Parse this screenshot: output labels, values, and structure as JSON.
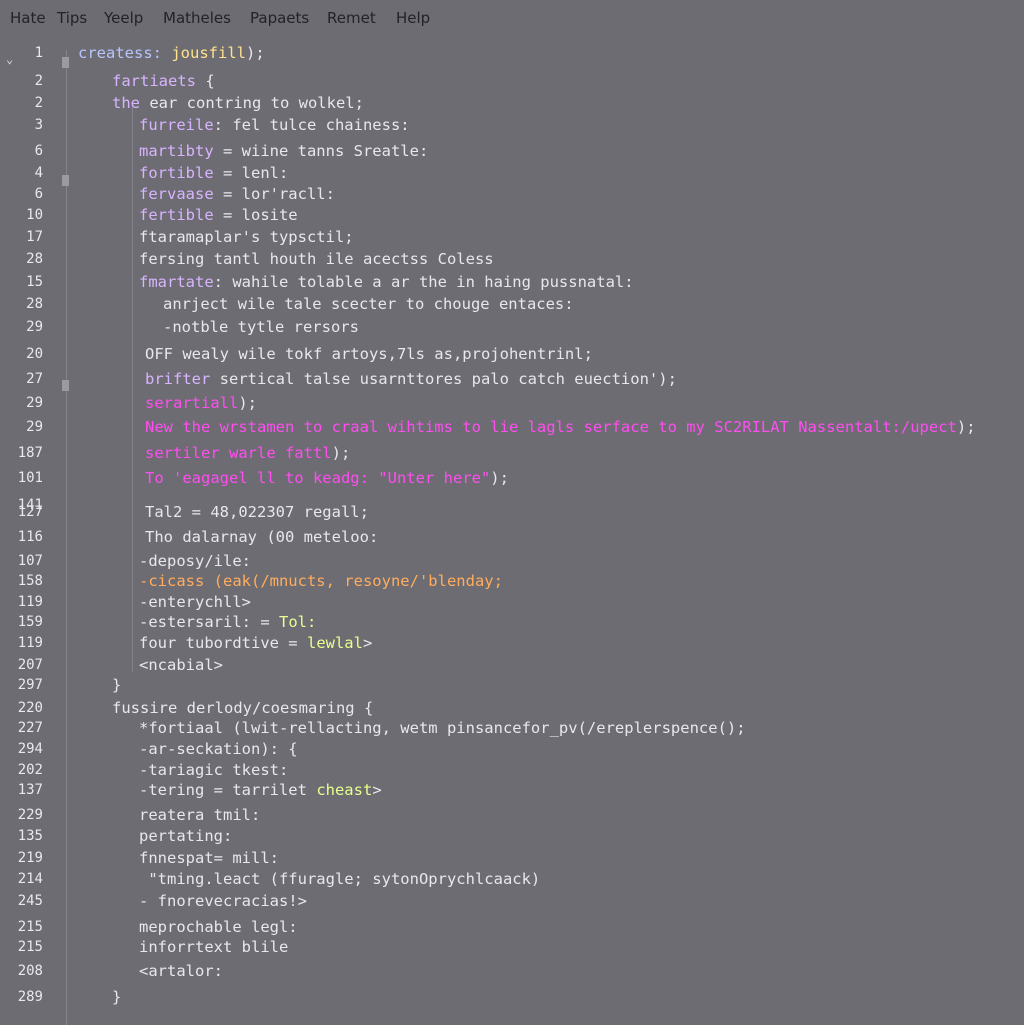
{
  "menu": [
    "Hate",
    "Tips",
    "Yeelp",
    "Matheles",
    "Papaets",
    "Remet",
    "Help"
  ],
  "lines": [
    {
      "n": "1",
      "indent": 0,
      "parts": [
        {
          "t": "createss: ",
          "c": "c-blue"
        },
        {
          "t": "jousfill",
          "c": "c-yellow"
        },
        {
          "t": ");",
          "c": ""
        }
      ]
    },
    {
      "n": "2",
      "indent": 1,
      "parts": [
        {
          "t": "fartiaets",
          "c": "c-purple"
        },
        {
          "t": " {",
          "c": ""
        }
      ]
    },
    {
      "n": "2",
      "indent": 1,
      "parts": [
        {
          "t": "the",
          "c": "c-purple"
        },
        {
          "t": " ear contring to wolkel;",
          "c": ""
        }
      ]
    },
    {
      "n": "3",
      "indent": 2,
      "parts": [
        {
          "t": "furreile",
          "c": "c-purple"
        },
        {
          "t": ": fel tulce chainess:",
          "c": ""
        }
      ]
    },
    {
      "n": "6",
      "indent": 2,
      "parts": [
        {
          "t": "martibty",
          "c": "c-purple"
        },
        {
          "t": " = wiine tanns Sreatle:",
          "c": ""
        }
      ]
    },
    {
      "n": "4",
      "indent": 2,
      "parts": [
        {
          "t": "fortible",
          "c": "c-purple"
        },
        {
          "t": " = lenl:",
          "c": ""
        }
      ]
    },
    {
      "n": "6",
      "indent": 2,
      "parts": [
        {
          "t": "fervaase",
          "c": "c-purple"
        },
        {
          "t": " = lor'racll:",
          "c": ""
        }
      ]
    },
    {
      "n": "10",
      "indent": 2,
      "parts": [
        {
          "t": "fertible",
          "c": "c-purple"
        },
        {
          "t": " = losite",
          "c": ""
        }
      ]
    },
    {
      "n": "17",
      "indent": 2,
      "parts": [
        {
          "t": "ftaramaplar's typsctil;",
          "c": ""
        }
      ]
    },
    {
      "n": "28",
      "indent": 2,
      "parts": [
        {
          "t": "fersing tantl houth ile acectss Coless",
          "c": ""
        }
      ]
    },
    {
      "n": "15",
      "indent": 2,
      "parts": [
        {
          "t": "fmartate",
          "c": "c-purple"
        },
        {
          "t": ": wahile tolable a ar the in haing pussnatal:",
          "c": ""
        }
      ]
    },
    {
      "n": "28",
      "indent": 3,
      "parts": [
        {
          "t": "anrject wile tale scecter to chouge entaces:",
          "c": ""
        }
      ]
    },
    {
      "n": "29",
      "indent": 3,
      "parts": [
        {
          "t": "-notble tytle rersors",
          "c": ""
        }
      ]
    },
    {
      "n": "20",
      "indent": 2,
      "parts": [
        {
          "t": "OFF wealy wile tokf artoys,7ls as,projohentrinl;",
          "c": ""
        }
      ]
    },
    {
      "n": "27",
      "indent": 2,
      "parts": [
        {
          "t": "brifter",
          "c": "c-purple"
        },
        {
          "t": " sertical talse usarnttores palo catch euection');",
          "c": ""
        }
      ]
    },
    {
      "n": "29",
      "indent": 2,
      "parts": [
        {
          "t": "serartiall",
          "c": "c-magenta"
        },
        {
          "t": ");",
          "c": ""
        }
      ]
    },
    {
      "n": "29",
      "indent": 2,
      "parts": [
        {
          "t": "New the wrstamen to craal wihtims to lie lagls serface to my SC2RILAT Nassentalt:/upect",
          "c": "c-magenta"
        },
        {
          "t": ");",
          "c": ""
        }
      ]
    },
    {
      "n": "187",
      "indent": 2,
      "parts": [
        {
          "t": "sertiler warle fattl",
          "c": "c-magenta"
        },
        {
          "t": ");",
          "c": ""
        }
      ]
    },
    {
      "n": "101",
      "indent": 2,
      "parts": [
        {
          "t": "To 'eagagel ll to keadg: \"Unter here\"",
          "c": "c-magenta"
        },
        {
          "t": ");",
          "c": ""
        }
      ]
    },
    {
      "n": "141",
      "indent": 0,
      "parts": []
    },
    {
      "n": "127",
      "indent": 2,
      "parts": [
        {
          "t": "Tal2 = 48,022307 regall;",
          "c": ""
        }
      ]
    },
    {
      "n": "116",
      "indent": 2,
      "parts": [
        {
          "t": "Tho dalarnay (00 meteloo:",
          "c": ""
        }
      ]
    },
    {
      "n": "107",
      "indent": 2,
      "parts": [
        {
          "t": "-deposy/ile:",
          "c": ""
        }
      ]
    },
    {
      "n": "158",
      "indent": 2,
      "parts": [
        {
          "t": "-cicass (eak(/mnucts, resoyne/'blenday;",
          "c": "c-orange"
        }
      ]
    },
    {
      "n": "119",
      "indent": 2,
      "parts": [
        {
          "t": "-enterychll>",
          "c": ""
        }
      ]
    },
    {
      "n": "159",
      "indent": 2,
      "parts": [
        {
          "t": "-estersaril: = ",
          "c": ""
        },
        {
          "t": "Tol:",
          "c": "c-lime"
        }
      ]
    },
    {
      "n": "119",
      "indent": 2,
      "parts": [
        {
          "t": "four tubordtive = ",
          "c": ""
        },
        {
          "t": "lewlal",
          "c": "c-lime"
        },
        {
          "t": ">",
          "c": ""
        }
      ]
    },
    {
      "n": "207",
      "indent": 2,
      "parts": [
        {
          "t": "<ncabial>",
          "c": ""
        }
      ]
    },
    {
      "n": "297",
      "indent": 1,
      "parts": [
        {
          "t": "}",
          "c": ""
        }
      ]
    },
    {
      "n": "220",
      "indent": 1,
      "parts": [
        {
          "t": "fussire derlody/coesmaring {",
          "c": ""
        }
      ]
    },
    {
      "n": "227",
      "indent": 2,
      "parts": [
        {
          "t": "*fortiaal (lwit-rellacting, wetm pinsancefor_pv(/ereplerspence();",
          "c": ""
        }
      ]
    },
    {
      "n": "294",
      "indent": 2,
      "parts": [
        {
          "t": "-ar-seckation): {",
          "c": ""
        }
      ]
    },
    {
      "n": "202",
      "indent": 2,
      "parts": [
        {
          "t": "-tariagic tkest:",
          "c": ""
        }
      ]
    },
    {
      "n": "137",
      "indent": 2,
      "parts": [
        {
          "t": "-tering = tarrilet ",
          "c": ""
        },
        {
          "t": "cheast",
          "c": "c-lime"
        },
        {
          "t": ">",
          "c": ""
        }
      ]
    },
    {
      "n": "229",
      "indent": 2,
      "parts": [
        {
          "t": "reatera tmil:",
          "c": ""
        }
      ]
    },
    {
      "n": "135",
      "indent": 2,
      "parts": [
        {
          "t": "pertating:",
          "c": ""
        }
      ]
    },
    {
      "n": "219",
      "indent": 2,
      "parts": [
        {
          "t": "fnnespat= mill:",
          "c": ""
        }
      ]
    },
    {
      "n": "214",
      "indent": 2,
      "parts": [
        {
          "t": " \"tming.leact (ffuragle; sytonOprychlcaack)",
          "c": ""
        }
      ]
    },
    {
      "n": "245",
      "indent": 2,
      "parts": [
        {
          "t": "- fnorevecracias!>",
          "c": ""
        }
      ]
    },
    {
      "n": "215",
      "indent": 2,
      "parts": [
        {
          "t": "meprochable legl:",
          "c": ""
        }
      ]
    },
    {
      "n": "215",
      "indent": 2,
      "parts": [
        {
          "t": "inforrtext blile",
          "c": ""
        }
      ]
    },
    {
      "n": "208",
      "indent": 2,
      "parts": [
        {
          "t": "<artalor:",
          "c": ""
        }
      ]
    },
    {
      "n": "289",
      "indent": 1,
      "parts": [
        {
          "t": "}",
          "c": ""
        }
      ]
    }
  ]
}
